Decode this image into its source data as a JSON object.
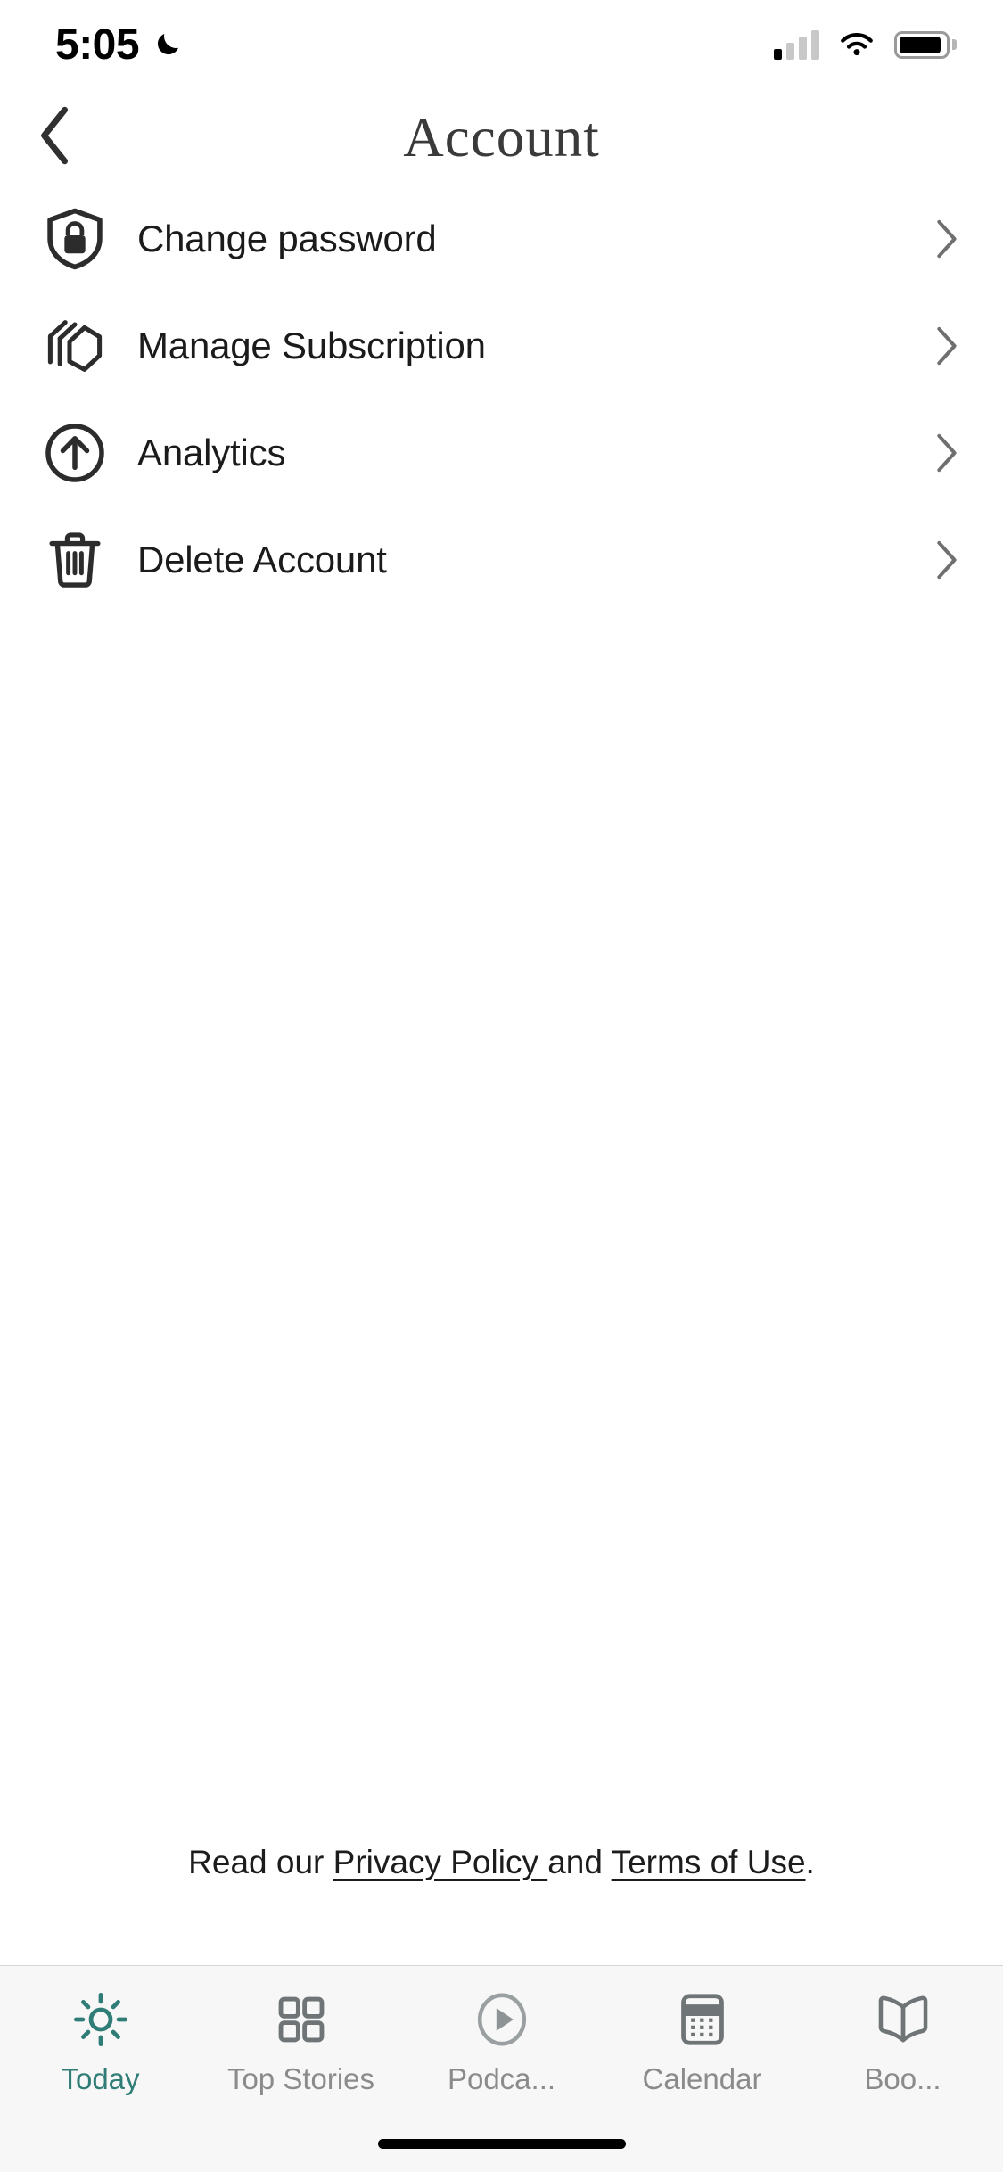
{
  "status_bar": {
    "time": "5:05",
    "dnd_icon": "crescent-moon-icon",
    "signal_icon": "cellular-signal-icon",
    "signal_bars_filled": 1,
    "signal_bars_total": 4,
    "wifi_icon": "wifi-icon",
    "battery_icon": "battery-icon",
    "battery_level_percent": 92
  },
  "nav": {
    "back_icon": "chevron-left-icon",
    "title": "Account"
  },
  "list": {
    "rows": [
      {
        "label": "Change password",
        "icon": "shield-lock-icon",
        "chevron": "chevron-right-icon"
      },
      {
        "label": "Manage Subscription",
        "icon": "stacked-pages-icon",
        "chevron": "chevron-right-icon"
      },
      {
        "label": "Analytics",
        "icon": "arrow-up-circle-icon",
        "chevron": "chevron-right-icon"
      },
      {
        "label": "Delete Account",
        "icon": "trash-icon",
        "chevron": "chevron-right-icon"
      }
    ]
  },
  "legal": {
    "prefix": "Read our ",
    "privacy_link": "Privacy Policy ",
    "conjunction": "and ",
    "terms_link": "Terms of Use",
    "suffix": "."
  },
  "tab_bar": {
    "active_color": "#2f7d76",
    "inactive_color": "#8b8b8b",
    "items": [
      {
        "label": "Today",
        "icon": "sun-icon",
        "active": true
      },
      {
        "label": "Top Stories",
        "icon": "grid-squares-icon",
        "active": false
      },
      {
        "label": "Podca...",
        "icon": "play-circle-icon",
        "active": false
      },
      {
        "label": "Calendar",
        "icon": "calendar-icon",
        "active": false
      },
      {
        "label": "Boo...",
        "icon": "open-book-icon",
        "active": false
      }
    ]
  }
}
